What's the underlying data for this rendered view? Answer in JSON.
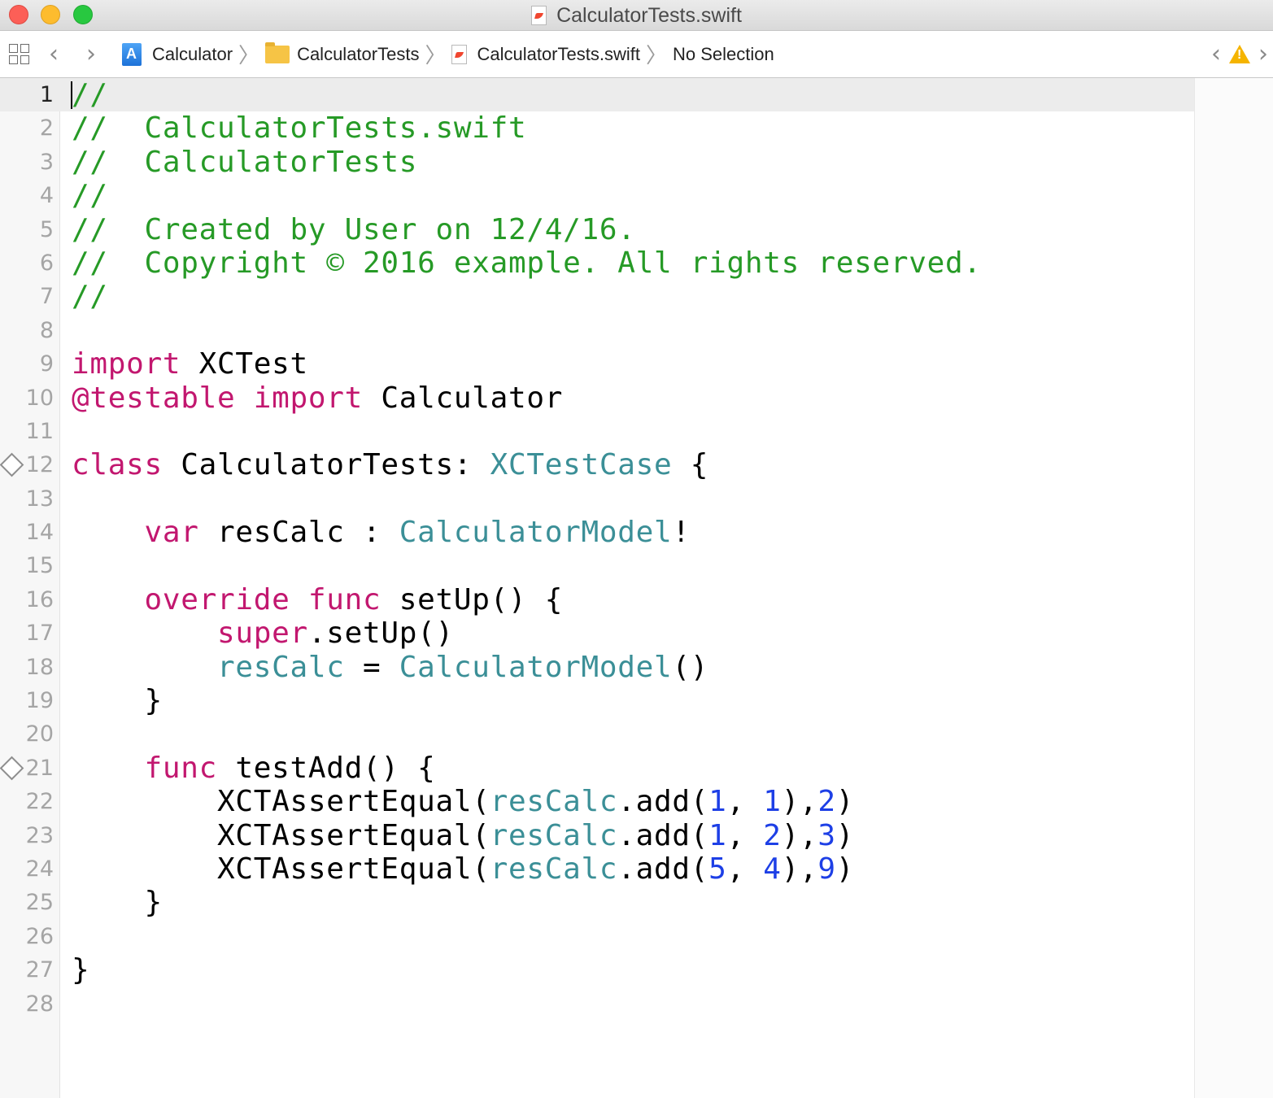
{
  "window": {
    "title": "CalculatorTests.swift"
  },
  "jumpbar": {
    "crumbs": [
      {
        "label": "Calculator",
        "icon": "xcode-project-icon"
      },
      {
        "label": "CalculatorTests",
        "icon": "folder-icon"
      },
      {
        "label": "CalculatorTests.swift",
        "icon": "swift-file-icon"
      },
      {
        "label": "No Selection",
        "icon": ""
      }
    ]
  },
  "editor": {
    "current_line": 1,
    "colors": {
      "comment": "#269a26",
      "keyword": "#c2176f",
      "type": "#3b8f97",
      "number": "#1d3fe6",
      "plain": "#000000"
    },
    "lines": [
      {
        "n": "1",
        "tokens": [
          {
            "t": "//",
            "k": "comment"
          }
        ]
      },
      {
        "n": "2",
        "tokens": [
          {
            "t": "//  CalculatorTests.swift",
            "k": "comment"
          }
        ]
      },
      {
        "n": "3",
        "tokens": [
          {
            "t": "//  CalculatorTests",
            "k": "comment"
          }
        ]
      },
      {
        "n": "4",
        "tokens": [
          {
            "t": "//",
            "k": "comment"
          }
        ]
      },
      {
        "n": "5",
        "tokens": [
          {
            "t": "//  Created by User on 12/4/16.",
            "k": "comment"
          }
        ]
      },
      {
        "n": "6",
        "tokens": [
          {
            "t": "//  Copyright © 2016 example. All rights reserved.",
            "k": "comment"
          }
        ]
      },
      {
        "n": "7",
        "tokens": [
          {
            "t": "//",
            "k": "comment"
          }
        ]
      },
      {
        "n": "8",
        "tokens": []
      },
      {
        "n": "9",
        "tokens": [
          {
            "t": "import",
            "k": "keyword"
          },
          {
            "t": " XCTest",
            "k": "plain"
          }
        ]
      },
      {
        "n": "10",
        "tokens": [
          {
            "t": "@testable",
            "k": "keyword"
          },
          {
            "t": " ",
            "k": "plain"
          },
          {
            "t": "import",
            "k": "keyword"
          },
          {
            "t": " Calculator",
            "k": "plain"
          }
        ]
      },
      {
        "n": "11",
        "tokens": []
      },
      {
        "n": "12",
        "test_diamond": true,
        "tokens": [
          {
            "t": "class",
            "k": "keyword"
          },
          {
            "t": " CalculatorTests: ",
            "k": "plain"
          },
          {
            "t": "XCTestCase",
            "k": "type"
          },
          {
            "t": " {",
            "k": "plain"
          }
        ]
      },
      {
        "n": "13",
        "tokens": []
      },
      {
        "n": "14",
        "tokens": [
          {
            "t": "    ",
            "k": "plain"
          },
          {
            "t": "var",
            "k": "keyword"
          },
          {
            "t": " resCalc : ",
            "k": "plain"
          },
          {
            "t": "CalculatorModel",
            "k": "type"
          },
          {
            "t": "!",
            "k": "plain"
          }
        ]
      },
      {
        "n": "15",
        "tokens": []
      },
      {
        "n": "16",
        "tokens": [
          {
            "t": "    ",
            "k": "plain"
          },
          {
            "t": "override",
            "k": "keyword"
          },
          {
            "t": " ",
            "k": "plain"
          },
          {
            "t": "func",
            "k": "keyword"
          },
          {
            "t": " setUp() {",
            "k": "plain"
          }
        ]
      },
      {
        "n": "17",
        "tokens": [
          {
            "t": "        ",
            "k": "plain"
          },
          {
            "t": "super",
            "k": "keyword"
          },
          {
            "t": ".setUp()",
            "k": "plain"
          }
        ]
      },
      {
        "n": "18",
        "tokens": [
          {
            "t": "        ",
            "k": "plain"
          },
          {
            "t": "resCalc",
            "k": "type"
          },
          {
            "t": " = ",
            "k": "plain"
          },
          {
            "t": "CalculatorModel",
            "k": "type"
          },
          {
            "t": "()",
            "k": "plain"
          }
        ]
      },
      {
        "n": "19",
        "tokens": [
          {
            "t": "    }",
            "k": "plain"
          }
        ]
      },
      {
        "n": "20",
        "tokens": []
      },
      {
        "n": "21",
        "test_diamond": true,
        "tokens": [
          {
            "t": "    ",
            "k": "plain"
          },
          {
            "t": "func",
            "k": "keyword"
          },
          {
            "t": " testAdd() {",
            "k": "plain"
          }
        ]
      },
      {
        "n": "22",
        "tokens": [
          {
            "t": "        XCTAssertEqual(",
            "k": "plain"
          },
          {
            "t": "resCalc",
            "k": "type"
          },
          {
            "t": ".add(",
            "k": "plain"
          },
          {
            "t": "1",
            "k": "number"
          },
          {
            "t": ", ",
            "k": "plain"
          },
          {
            "t": "1",
            "k": "number"
          },
          {
            "t": "),",
            "k": "plain"
          },
          {
            "t": "2",
            "k": "number"
          },
          {
            "t": ")",
            "k": "plain"
          }
        ]
      },
      {
        "n": "23",
        "tokens": [
          {
            "t": "        XCTAssertEqual(",
            "k": "plain"
          },
          {
            "t": "resCalc",
            "k": "type"
          },
          {
            "t": ".add(",
            "k": "plain"
          },
          {
            "t": "1",
            "k": "number"
          },
          {
            "t": ", ",
            "k": "plain"
          },
          {
            "t": "2",
            "k": "number"
          },
          {
            "t": "),",
            "k": "plain"
          },
          {
            "t": "3",
            "k": "number"
          },
          {
            "t": ")",
            "k": "plain"
          }
        ]
      },
      {
        "n": "24",
        "tokens": [
          {
            "t": "        XCTAssertEqual(",
            "k": "plain"
          },
          {
            "t": "resCalc",
            "k": "type"
          },
          {
            "t": ".add(",
            "k": "plain"
          },
          {
            "t": "5",
            "k": "number"
          },
          {
            "t": ", ",
            "k": "plain"
          },
          {
            "t": "4",
            "k": "number"
          },
          {
            "t": "),",
            "k": "plain"
          },
          {
            "t": "9",
            "k": "number"
          },
          {
            "t": ")",
            "k": "plain"
          }
        ]
      },
      {
        "n": "25",
        "tokens": [
          {
            "t": "    }",
            "k": "plain"
          }
        ]
      },
      {
        "n": "26",
        "tokens": []
      },
      {
        "n": "27",
        "tokens": [
          {
            "t": "}",
            "k": "plain"
          }
        ]
      },
      {
        "n": "28",
        "tokens": []
      }
    ]
  }
}
